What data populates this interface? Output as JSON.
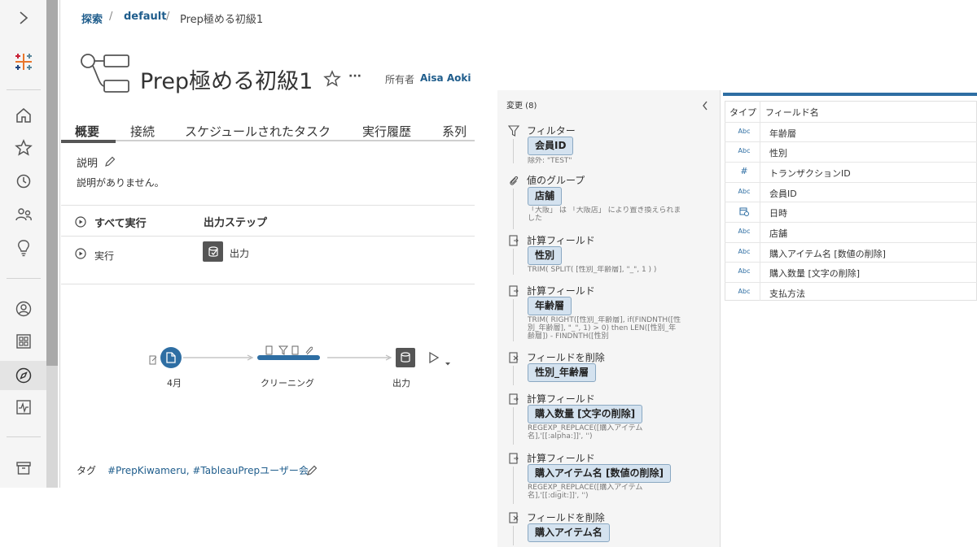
{
  "breadcrumb": {
    "root": "探索",
    "project": "default",
    "current": "Prep極める初級1"
  },
  "flow": {
    "title": "Prep極める初級1",
    "owner_label": "所有者",
    "owner_name": "Aisa Aoki",
    "more": "···"
  },
  "tabs": [
    "概要",
    "接続",
    "スケジュールされたタスク",
    "実行履歴",
    "系列"
  ],
  "description": {
    "label": "説明",
    "text": "説明がありません。"
  },
  "run": {
    "run_all": "すべて実行",
    "output_steps_header": "出力ステップ",
    "run": "実行",
    "output": "出力"
  },
  "diagram": {
    "input": "4月",
    "clean": "クリーニング",
    "output": "出力"
  },
  "tags": {
    "label": "タグ",
    "value": "#PrepKiwameru, #TableauPrepユーザー会"
  },
  "changes": {
    "title": "変更 (8)",
    "items": [
      {
        "type": "フィルター",
        "icon": "filter-icon",
        "field": "会員ID",
        "note": "除外: \"TEST\""
      },
      {
        "type": "値のグループ",
        "icon": "paperclip-icon",
        "field": "店舗",
        "note": "「大阪」 は 「大阪店」 により置き換えられました"
      },
      {
        "type": "計算フィールド",
        "icon": "calc-field-icon",
        "field": "性別",
        "note": "TRIM( SPLIT( [性別_年齢層], \"_\", 1 ) )"
      },
      {
        "type": "計算フィールド",
        "icon": "calc-field-icon",
        "field": "年齢層",
        "note": "TRIM( RIGHT([性別_年齢層], if(FINDNTH([性別_年齢層], \"_\", 1) > 0) then LEN([性別_年齢層]) - FINDNTH([性別"
      },
      {
        "type": "フィールドを削除",
        "icon": "remove-field-icon",
        "field": "性別_年齢層",
        "note": ""
      },
      {
        "type": "計算フィールド",
        "icon": "calc-field-icon",
        "field": "購入数量 [文字の削除]",
        "note": "REGEXP_REPLACE([購入アイテム名],'[[:alpha:]]', '')"
      },
      {
        "type": "計算フィールド",
        "icon": "calc-field-icon",
        "field": "購入アイテム名 [数値の削除]",
        "note": "REGEXP_REPLACE([購入アイテム名],'[[:digit:]]', '')"
      },
      {
        "type": "フィールドを削除",
        "icon": "remove-field-icon",
        "field": "購入アイテム名",
        "note": ""
      }
    ]
  },
  "fields": {
    "headers": {
      "type": "タイプ",
      "name": "フィールド名"
    },
    "rows": [
      {
        "type": "Abc",
        "name": "年齢層"
      },
      {
        "type": "Abc",
        "name": "性別"
      },
      {
        "type": "#",
        "name": "トランザクションID"
      },
      {
        "type": "Abc",
        "name": "会員ID"
      },
      {
        "type": "date-icon",
        "name": "日時"
      },
      {
        "type": "Abc",
        "name": "店舗"
      },
      {
        "type": "Abc",
        "name": "購入アイテム名 [数値の削除]"
      },
      {
        "type": "Abc",
        "name": "購入数量 [文字の削除]"
      },
      {
        "type": "Abc",
        "name": "支払方法"
      }
    ]
  },
  "colors": {
    "link": "#1f5d8c",
    "accent": "#2e6ea3",
    "chip_bg": "#d4e2ef"
  }
}
